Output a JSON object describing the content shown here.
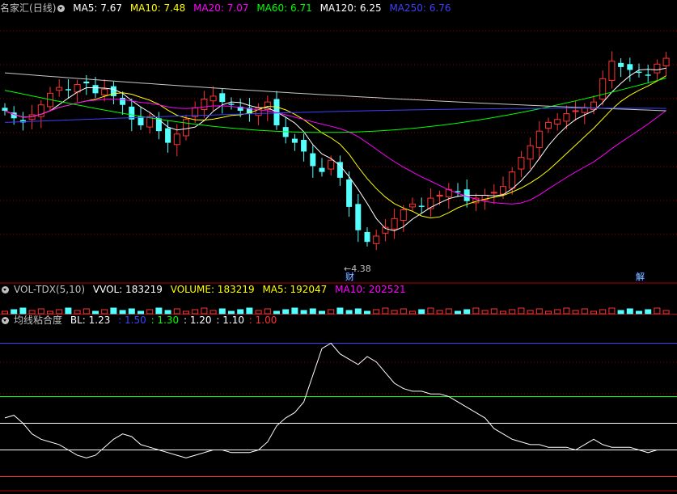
{
  "header_main": {
    "name": "名家汇",
    "period": "(日线)",
    "items": [
      {
        "label": "MA5: 7.67",
        "color": "#ffffff"
      },
      {
        "label": "MA10: 7.48",
        "color": "#ffff00"
      },
      {
        "label": "MA20: 7.07",
        "color": "#ff00ff"
      },
      {
        "label": "MA60: 6.71",
        "color": "#00ff00"
      },
      {
        "label": "MA120: 6.25",
        "color": "#ffffff"
      },
      {
        "label": "MA250: 6.76",
        "color": "#3f3fff"
      }
    ]
  },
  "header_vol": {
    "name": "VOL-TDX(5,10)",
    "items": [
      {
        "label": "VVOL: 183219",
        "color": "#ffffff"
      },
      {
        "label": "VOLUME: 183219",
        "color": "#ffff00"
      },
      {
        "label": "MA5: 192047",
        "color": "#ffff00"
      },
      {
        "label": "MA10: 202521",
        "color": "#ff00ff"
      }
    ]
  },
  "header_ind": {
    "name": "均线粘合度",
    "items": [
      {
        "label": "BL: 1.23",
        "color": "#ffffff"
      },
      {
        "label": ": 1.50",
        "color": "#3f3fff"
      },
      {
        "label": ": 1.30",
        "color": "#00ff00"
      },
      {
        "label": ": 1.20",
        "color": "#ffffff"
      },
      {
        "label": ": 1.10",
        "color": "#ffffff"
      },
      {
        "label": ": 1.00",
        "color": "#ff3030"
      }
    ]
  },
  "annotations": {
    "low_label": "4.38",
    "tag_cai": "财",
    "tag_jie": "解"
  },
  "colors": {
    "up": "#ff3232",
    "down": "#54ffff",
    "grid": "#8b0000",
    "ma5": "#ffffff",
    "ma10": "#ffff00",
    "ma20": "#ff00ff",
    "ma60": "#00ff00",
    "ma120": "#c8c8c8",
    "ma250": "#3f3fff"
  },
  "chart_data": {
    "type": "candlestick",
    "ylim": [
      4.1,
      8.4
    ],
    "ma_levels": {
      "ma120_start": 7.4,
      "ma60_start": 7.1
    },
    "indicator": {
      "name": "均线粘合度",
      "ylim": [
        0.95,
        1.55
      ],
      "levels": [
        1.5,
        1.3,
        1.2,
        1.1,
        1.0
      ],
      "bl": [
        1.22,
        1.23,
        1.2,
        1.16,
        1.14,
        1.13,
        1.12,
        1.1,
        1.08,
        1.07,
        1.08,
        1.11,
        1.14,
        1.16,
        1.15,
        1.12,
        1.11,
        1.1,
        1.09,
        1.08,
        1.07,
        1.08,
        1.09,
        1.1,
        1.1,
        1.09,
        1.09,
        1.09,
        1.1,
        1.13,
        1.19,
        1.22,
        1.24,
        1.28,
        1.38,
        1.48,
        1.5,
        1.46,
        1.44,
        1.42,
        1.45,
        1.43,
        1.39,
        1.35,
        1.33,
        1.32,
        1.32,
        1.31,
        1.31,
        1.3,
        1.28,
        1.26,
        1.24,
        1.22,
        1.18,
        1.16,
        1.14,
        1.13,
        1.12,
        1.12,
        1.11,
        1.11,
        1.11,
        1.1,
        1.12,
        1.14,
        1.12,
        1.11,
        1.11,
        1.11,
        1.1,
        1.09,
        1.1,
        1.1
      ]
    }
  }
}
